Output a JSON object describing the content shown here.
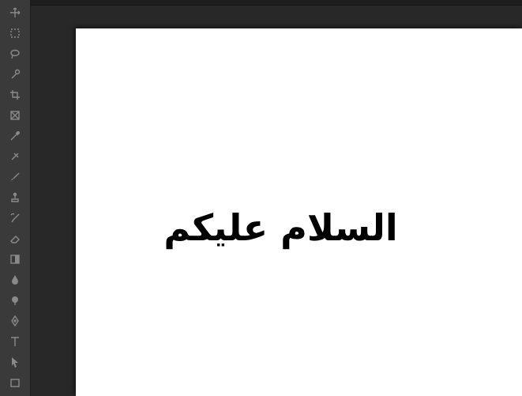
{
  "canvas": {
    "text": "السلام عليكم",
    "background": "#ffffff",
    "text_color": "#000000"
  },
  "theme": {
    "workspace": "#282828",
    "toolbar": "#3a3a3a",
    "icon": "#8a8a8a"
  },
  "toolbar": {
    "tools": [
      "move-tool-icon",
      "marquee-tool-icon",
      "lasso-tool-icon",
      "quick-selection-tool-icon",
      "crop-tool-icon",
      "frame-tool-icon",
      "eyedropper-tool-icon",
      "healing-brush-tool-icon",
      "brush-tool-icon",
      "clone-stamp-tool-icon",
      "history-brush-tool-icon",
      "eraser-tool-icon",
      "gradient-tool-icon",
      "blur-tool-icon",
      "dodge-tool-icon",
      "pen-tool-icon",
      "type-tool-icon",
      "path-selection-tool-icon",
      "rectangle-tool-icon"
    ]
  }
}
